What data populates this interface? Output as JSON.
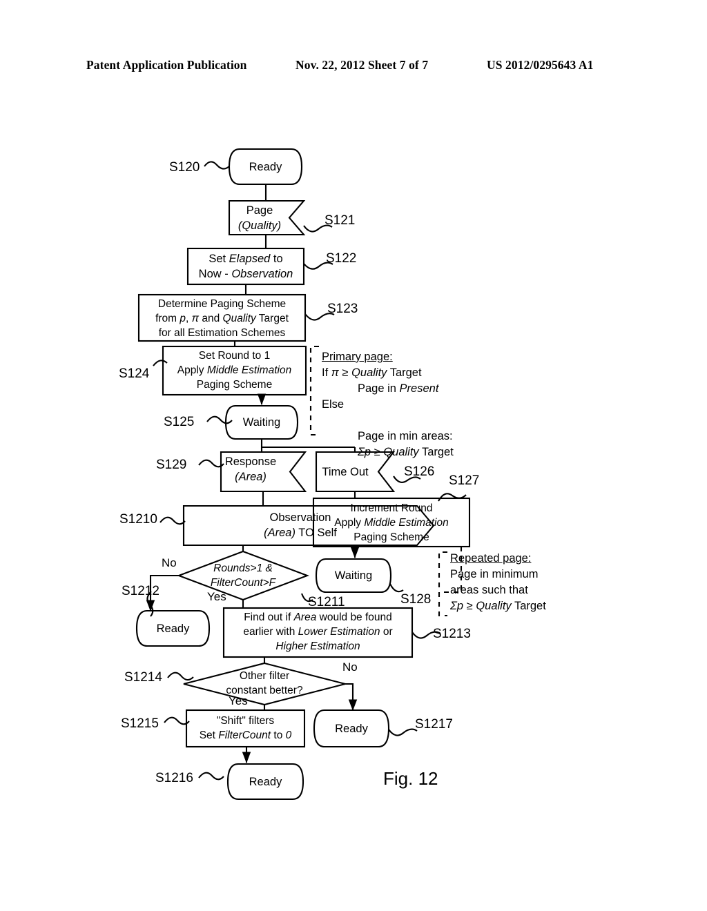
{
  "header": {
    "left": "Patent Application Publication",
    "middle": "Nov. 22, 2012  Sheet 7 of 7",
    "right": "US 2012/0295643 A1"
  },
  "figure": {
    "caption": "Fig. 12",
    "nodes": {
      "s120": {
        "ref": "S120",
        "shape": "terminator",
        "lines": [
          "Ready"
        ]
      },
      "s121": {
        "ref": "S121",
        "shape": "signal-receive",
        "lines": [
          "Page",
          "(Quality)"
        ]
      },
      "s122": {
        "ref": "S122",
        "shape": "process",
        "lines": [
          "Set Elapsed to",
          "Now - Observation"
        ]
      },
      "s123": {
        "ref": "S123",
        "shape": "process",
        "lines": [
          "Determine Paging Scheme",
          "from p, π and Quality Target",
          "for all Estimation Schemes"
        ]
      },
      "s124": {
        "ref": "S124",
        "shape": "process",
        "lines": [
          "Set Round to 1",
          "Apply Middle Estimation",
          "Paging Scheme"
        ]
      },
      "s125": {
        "ref": "S125",
        "shape": "terminator",
        "lines": [
          "Waiting"
        ]
      },
      "s129": {
        "ref": "S129",
        "shape": "signal-receive",
        "lines": [
          "Response",
          "(Area)"
        ]
      },
      "s126": {
        "ref": "S126",
        "shape": "signal-receive",
        "lines": [
          "Time Out"
        ]
      },
      "s127": {
        "ref": "S127",
        "shape": "process",
        "lines": [
          "Increment Round",
          "Apply Middle Estimation",
          "Paging Scheme"
        ]
      },
      "s1210": {
        "ref": "S1210",
        "shape": "signal-send",
        "lines": [
          "Observation",
          "(Area) TO Self"
        ]
      },
      "s1211": {
        "ref": "S1211",
        "shape": "decision",
        "lines": [
          "Rounds>1 &",
          "FilterCount>F"
        ]
      },
      "s128": {
        "ref": "S128",
        "shape": "terminator",
        "lines": [
          "Waiting"
        ]
      },
      "s1212": {
        "ref": "S1212",
        "shape": "terminator",
        "lines": [
          "Ready"
        ]
      },
      "s1213": {
        "ref": "S1213",
        "shape": "process",
        "lines": [
          "Find out if Area would be found",
          "earlier with Lower Estimation or",
          "Higher Estimation"
        ]
      },
      "s1214": {
        "ref": "S1214",
        "shape": "decision",
        "lines": [
          "Other filter",
          "constant better?"
        ]
      },
      "s1215": {
        "ref": "S1215",
        "shape": "process",
        "lines": [
          "\"Shift\" filters",
          "Set FilterCount to 0"
        ]
      },
      "s1217": {
        "ref": "S1217",
        "shape": "terminator",
        "lines": [
          "Ready"
        ]
      },
      "s1216": {
        "ref": "S1216",
        "shape": "terminator",
        "lines": [
          "Ready"
        ]
      }
    },
    "edge_labels": {
      "rounds_no": "No",
      "rounds_yes": "Yes",
      "filter_no": "No",
      "filter_yes": "Yes"
    },
    "notes": {
      "primary": {
        "title": "Primary page:",
        "lines": [
          "If π ≥ Quality Target",
          "Page in Present",
          "Else",
          "",
          "Page in min areas:",
          "Σp ≥ Quality Target"
        ]
      },
      "repeated": {
        "title": "Repeated page:",
        "lines": [
          "Page in minimum",
          "areas such that",
          "Σp ≥ Quality Target"
        ]
      }
    }
  }
}
